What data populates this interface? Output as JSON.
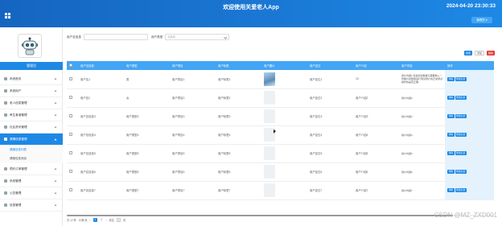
{
  "app": {
    "title": "欢迎使用关爱老人App",
    "clock": "2024-04-20 23:30:33",
    "user_button": "管理员 ▾"
  },
  "sidebar": {
    "role": "管理员",
    "items": [
      {
        "label": "系统首页",
        "icon": "home-icon",
        "expanded": false,
        "active": false
      },
      {
        "label": "系统用户",
        "icon": "users-icon",
        "expanded": false,
        "active": false
      },
      {
        "label": "老人信息管理",
        "icon": "elder-icon",
        "expanded": false,
        "active": false
      },
      {
        "label": "养生食谱管理",
        "icon": "recipe-icon",
        "expanded": false,
        "active": false
      },
      {
        "label": "社区资讯管理",
        "icon": "news-icon",
        "expanded": false,
        "active": false
      },
      {
        "label": "健康信息管理",
        "icon": "health-icon",
        "expanded": true,
        "active": true
      },
      {
        "label": "预约订单管理",
        "icon": "order-icon",
        "expanded": false,
        "active": false
      },
      {
        "label": "系统管理",
        "icon": "gear-icon",
        "expanded": false,
        "active": false
      },
      {
        "label": "公告管理",
        "icon": "notice-icon",
        "expanded": false,
        "active": false
      },
      {
        "label": "信息管理",
        "icon": "info-icon",
        "expanded": false,
        "active": false
      }
    ],
    "sub_items": [
      "健康信息列表",
      "健康信息添加"
    ]
  },
  "filters": {
    "name_label": "用户名信息",
    "type_label": "用户类型",
    "type_placeholder": "请选择"
  },
  "actions": {
    "search": "搜索",
    "add": "添加",
    "delete": "删除"
  },
  "table": {
    "headers": [
      "",
      "用户名信息",
      "用户类型",
      "用户项目",
      "用户标签",
      "用户图片",
      "用户定位",
      "用户介绍",
      "用户内容",
      "操作"
    ],
    "rows": [
      {
        "name": "用户名1",
        "type": "男",
        "item": "用户项目1",
        "tag": "用户标签1",
        "photo": true,
        "loc": "用户定位1",
        "intro": "10",
        "content": "用户内容1 就是测试数据只需要填入一张图片就能够进行测试用户的正常测试操作的是否正确",
        "photo_placeholder": false
      },
      {
        "name": "用户名2",
        "type": "女",
        "item": "用户项目2",
        "tag": "用户标签2",
        "photo": false,
        "loc": "用户定位2",
        "intro": "用户介绍2",
        "content": "用户内容2"
      },
      {
        "name": "用户名信息3",
        "type": "用户类型3",
        "item": "用户项目3",
        "tag": "用户标签3",
        "photo": false,
        "loc": "用户定位3",
        "intro": "用户介绍3",
        "content": "用户内容3"
      },
      {
        "name": "用户名信息4",
        "type": "用户类型4",
        "item": "用户项目4",
        "tag": "用户标签4",
        "photo": false,
        "loc": "用户定位4",
        "intro": "用户介绍4",
        "content": "用户内容4"
      },
      {
        "name": "用户名信息5",
        "type": "用户类型5",
        "item": "用户项目5",
        "tag": "用户标签5",
        "photo": false,
        "loc": "用户定位5",
        "intro": "用户介绍5",
        "content": "用户内容5"
      },
      {
        "name": "用户名信息6",
        "type": "用户类型6",
        "item": "用户项目6",
        "tag": "用户标签6",
        "photo": false,
        "loc": "用户定位6",
        "intro": "用户介绍6",
        "content": "用户内容6"
      },
      {
        "name": "用户名信息7",
        "type": "用户类型7",
        "item": "用户项目7",
        "tag": "用户标签7",
        "photo": false,
        "loc": "用户定位7",
        "intro": "用户介绍7",
        "content": "用户内容7"
      }
    ],
    "op_detail": "详情",
    "op_edit": "修改信息"
  },
  "pager": {
    "total": "共 12 条",
    "page_size": "10条/页",
    "pages": [
      "1",
      "2"
    ],
    "current": "1",
    "jump_label": "前往",
    "jump_value": "1",
    "page_suffix": "页"
  },
  "watermark": "CSDN @MZ_ZXD001",
  "colors": {
    "primary": "#1e88e5",
    "header": "#42a5f5",
    "danger": "#e53935"
  }
}
